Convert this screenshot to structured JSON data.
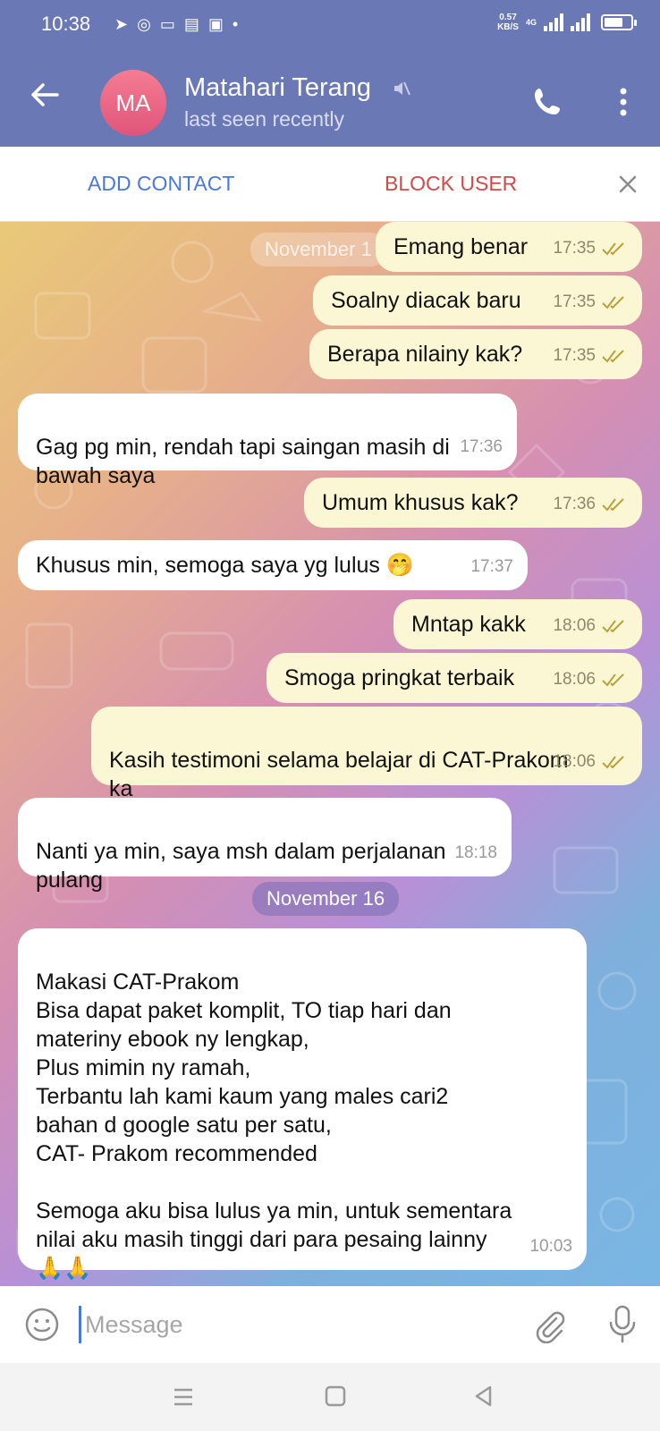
{
  "status_bar": {
    "time": "10:38",
    "notification_icons": [
      "telegram-icon",
      "whatsapp-icon",
      "app-icon",
      "card-icon",
      "shopee-icon",
      "dot-icon"
    ],
    "net_speed": "0.57",
    "net_unit": "KB/S",
    "network": "4G"
  },
  "header": {
    "avatar_initials": "MA",
    "contact_name": "Matahari Terang",
    "last_seen": "last seen recently"
  },
  "action_bar": {
    "add_contact": "ADD CONTACT",
    "block_user": "BLOCK USER"
  },
  "chat": {
    "date_top": "November 1",
    "date_mid": "November 16",
    "messages": [
      {
        "dir": "out",
        "text": "Emang benar",
        "time": "17:35"
      },
      {
        "dir": "out",
        "text": "Soalny diacak baru",
        "time": "17:35"
      },
      {
        "dir": "out",
        "text": "Berapa nilainy kak?",
        "time": "17:35"
      },
      {
        "dir": "in",
        "text": "Gag pg min, rendah tapi saingan masih di\nbawah saya",
        "time": "17:36"
      },
      {
        "dir": "out",
        "text": "Umum khusus kak?",
        "time": "17:36"
      },
      {
        "dir": "in",
        "text": "Khusus min, semoga saya yg lulus 🤭",
        "time": "17:37"
      },
      {
        "dir": "out",
        "text": "Mntap kakk",
        "time": "18:06"
      },
      {
        "dir": "out",
        "text": "Smoga pringkat terbaik",
        "time": "18:06"
      },
      {
        "dir": "out",
        "text": "Kasih testimoni selama belajar di CAT-Prakom\nka",
        "time": "18:06"
      },
      {
        "dir": "in",
        "text": "Nanti ya min, saya msh dalam perjalanan\npulang",
        "time": "18:18"
      },
      {
        "dir": "in",
        "text": "Makasi CAT-Prakom\nBisa dapat paket komplit, TO tiap hari dan\nmateriny ebook ny lengkap,\nPlus mimin ny ramah,\nTerbantu lah kami kaum yang males cari2\nbahan d google satu per satu,\nCAT- Prakom recommended\n\nSemoga aku bisa lulus ya min, untuk sementara\nnilai aku masih tinggi dari para pesaing lainny\n🙏🙏",
        "time": "10:03"
      }
    ]
  },
  "input": {
    "placeholder": "Message"
  },
  "colors": {
    "header": "#6a78b6",
    "outgoing_bubble": "#fbf7d5",
    "incoming_bubble": "#ffffff",
    "accent": "#4b7ad6",
    "danger": "#d14a4a"
  }
}
